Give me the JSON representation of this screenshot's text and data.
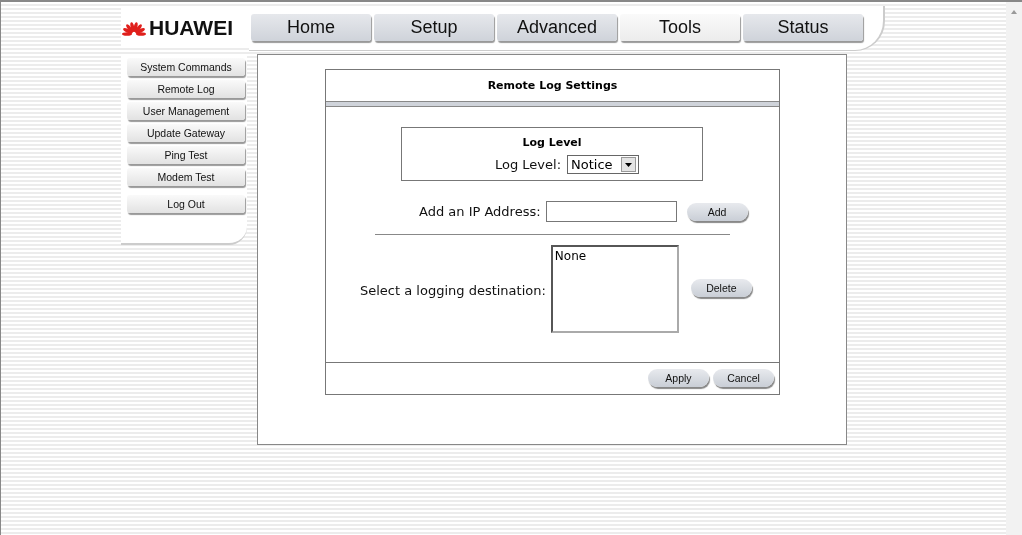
{
  "logo": {
    "text": "HUAWEI"
  },
  "tabs": [
    {
      "label": "Home",
      "selected": false
    },
    {
      "label": "Setup",
      "selected": false
    },
    {
      "label": "Advanced",
      "selected": false
    },
    {
      "label": "Tools",
      "selected": true
    },
    {
      "label": "Status",
      "selected": false
    }
  ],
  "sidebar": {
    "items": [
      {
        "label": "System Commands",
        "selected": false
      },
      {
        "label": "Remote Log",
        "selected": false
      },
      {
        "label": "User Management",
        "selected": false
      },
      {
        "label": "Update Gateway",
        "selected": false
      },
      {
        "label": "Ping Test",
        "selected": false
      },
      {
        "label": "Modem Test",
        "selected": false
      }
    ],
    "logout": "Log Out"
  },
  "panel": {
    "title": "Remote Log Settings",
    "log_level_box": {
      "title": "Log Level",
      "label": "Log Level:",
      "value": "Notice"
    },
    "ip": {
      "label": "Add an IP Address:",
      "button": "Add"
    },
    "destination": {
      "label": "Select a logging destination:",
      "options": [
        "None"
      ],
      "button": "Delete"
    },
    "buttons": [
      "Apply",
      "Cancel"
    ]
  }
}
